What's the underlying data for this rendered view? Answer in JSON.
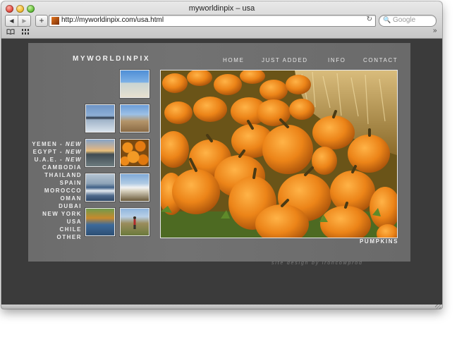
{
  "window": {
    "title": "myworldinpix – usa"
  },
  "toolbar": {
    "back_label": "◀",
    "forward_label": "▶",
    "add_label": "+",
    "url": "http://myworldinpix.com/usa.html",
    "reload_label": "↻",
    "search_placeholder": "Google",
    "bookmarks_more": "»"
  },
  "site": {
    "logo": "MYWORLDINPIX",
    "nav": [
      "HOME",
      "JUST ADDED",
      "INFO",
      "CONTACT"
    ],
    "countries": [
      {
        "name": "YEMEN - ",
        "tag": "NEW"
      },
      {
        "name": "EGYPT - ",
        "tag": "NEW"
      },
      {
        "name": "U.A.E. - ",
        "tag": "NEW"
      },
      {
        "name": "CAMBODIA",
        "tag": ""
      },
      {
        "name": "THAILAND",
        "tag": ""
      },
      {
        "name": "SPAIN",
        "tag": ""
      },
      {
        "name": "MOROCCO",
        "tag": ""
      },
      {
        "name": "OMAN",
        "tag": ""
      },
      {
        "name": "DUBAI",
        "tag": ""
      },
      {
        "name": "NEW YORK",
        "tag": ""
      },
      {
        "name": "USA",
        "tag": ""
      },
      {
        "name": "CHILE",
        "tag": ""
      },
      {
        "name": "OTHER",
        "tag": ""
      }
    ],
    "caption": "PUMPKINS",
    "credit": "site design by ironcowprod"
  },
  "colors": {
    "page_bg": "#3b3b3b",
    "panel_bg": "#6e6e6e",
    "pumpkin": "#e8861c",
    "hay": "#c9a560"
  }
}
